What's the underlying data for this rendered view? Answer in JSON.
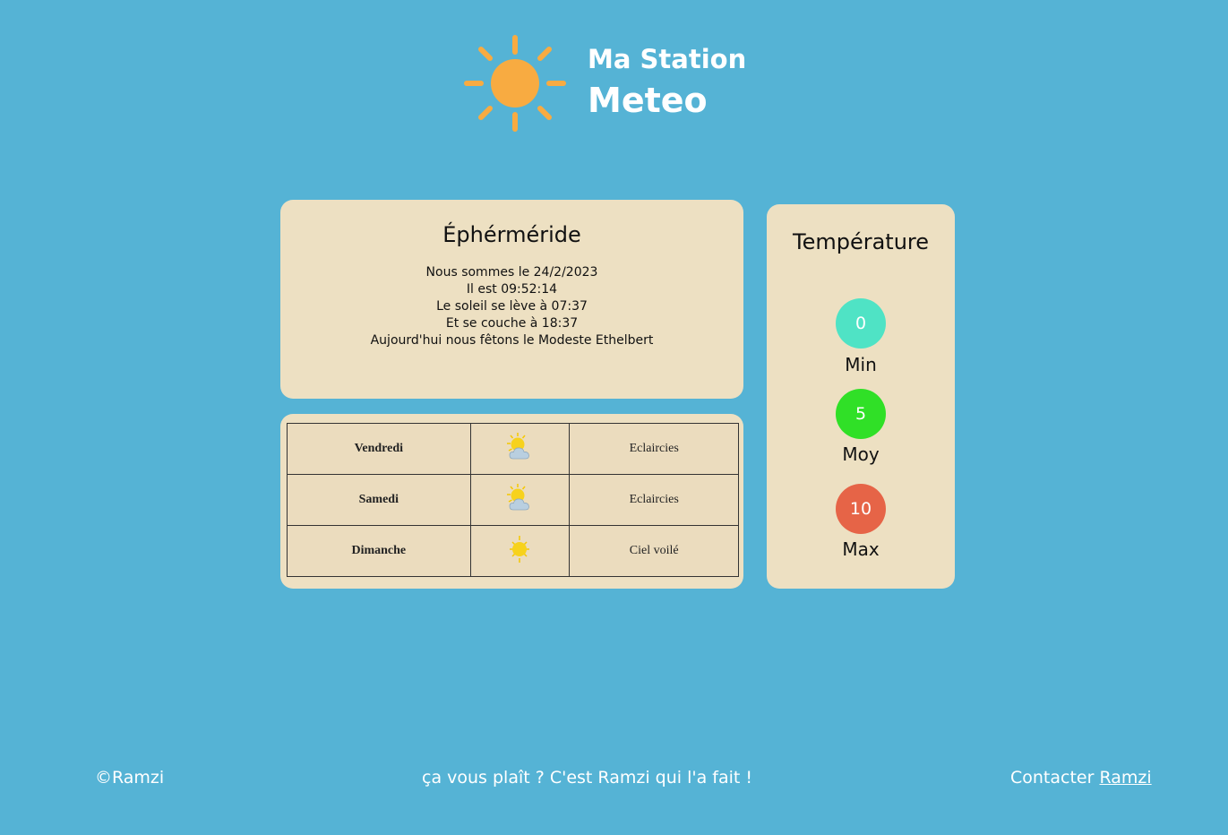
{
  "header": {
    "title_line1": "Ma Station",
    "title_line2": "Meteo",
    "logo_icon": "sun-icon"
  },
  "ephemeris": {
    "title": "Éphérméride",
    "date_line": "Nous sommes le 24/2/2023",
    "time_line": "Il est 09:52:14",
    "sunrise_line": "Le soleil se lève à 07:37",
    "sunset_line": "Et se couche à 18:37",
    "saint_line": "Aujourd'hui nous fêtons le Modeste Ethelbert"
  },
  "forecast": [
    {
      "day": "Vendredi",
      "icon": "sun-behind-cloud-icon",
      "description": "Eclaircies"
    },
    {
      "day": "Samedi",
      "icon": "sun-behind-cloud-icon",
      "description": "Eclaircies"
    },
    {
      "day": "Dimanche",
      "icon": "hazy-sun-icon",
      "description": "Ciel voilé"
    }
  ],
  "temperature": {
    "title": "Température",
    "min": {
      "value": "0",
      "label": "Min",
      "color": "#4fe3c5"
    },
    "avg": {
      "value": "5",
      "label": "Moy",
      "color": "#30e027"
    },
    "max": {
      "value": "10",
      "label": "Max",
      "color": "#e66447"
    }
  },
  "footer": {
    "copyright": "©Ramzi",
    "tagline": "ça vous plaît ? C'est Ramzi qui l'a fait !",
    "contact_prefix": "Contacter",
    "contact_link": "Ramzi"
  },
  "colors": {
    "background": "#55b3d5",
    "card": "#ede0c2",
    "sun": "#f8ab41"
  }
}
